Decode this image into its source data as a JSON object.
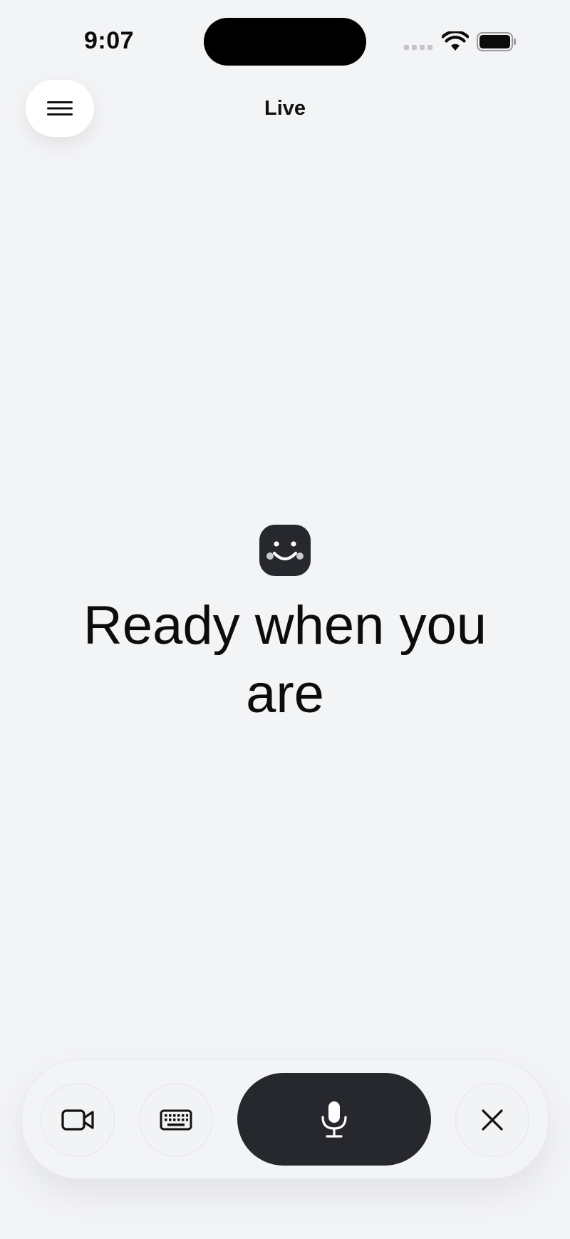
{
  "status_bar": {
    "time": "9:07"
  },
  "header": {
    "title": "Live",
    "menu_icon": "hamburger-menu-icon"
  },
  "main": {
    "logo_icon": "smiley-logo-icon",
    "headline": "Ready when you are"
  },
  "controls": {
    "video_icon": "video-camera-icon",
    "keyboard_icon": "keyboard-icon",
    "mic_icon": "microphone-icon",
    "close_icon": "close-icon"
  },
  "colors": {
    "background": "#f3f4f6",
    "dark_accent": "#26282e",
    "text": "#111111"
  }
}
